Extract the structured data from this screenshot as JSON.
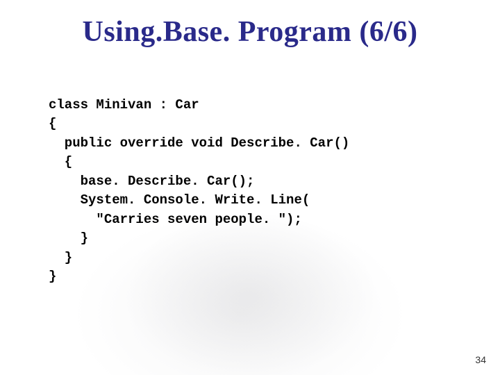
{
  "slide": {
    "title": "Using.Base. Program (6/6)",
    "page_number": "34",
    "code_lines": [
      "class Minivan : Car",
      "{",
      "  public override void Describe. Car()",
      "  {",
      "    base. Describe. Car();",
      "    System. Console. Write. Line(",
      "      \"Carries seven people. \");",
      "    }",
      "  }",
      "}"
    ]
  }
}
